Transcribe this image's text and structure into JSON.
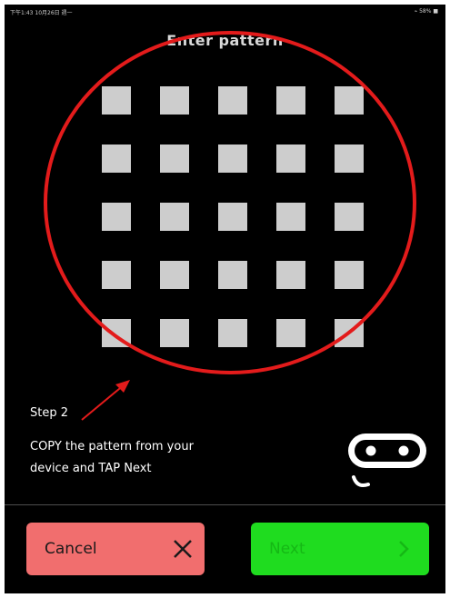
{
  "status_bar": {
    "left": "下午1:43 10月26日 週一",
    "right": "⌁ 58% ■"
  },
  "screen": {
    "title": "Enter pattern"
  },
  "pattern": {
    "rows": 5,
    "cols": 5
  },
  "annotation": {
    "circle_color": "#e31b1b",
    "arrow_color": "#e31b1b"
  },
  "instructions": {
    "step": "Step 2",
    "line1": "COPY the pattern from your",
    "line2": "device and TAP Next"
  },
  "buttons": {
    "cancel_label": "Cancel",
    "next_label": "Next"
  },
  "icons": {
    "cancel": "close-icon",
    "next": "chevron-right-icon",
    "device": "robot-face-icon"
  },
  "colors": {
    "background": "#000000",
    "cell": "#cdcdcd",
    "cancel": "#f16e6e",
    "next": "#1fdc1f",
    "next_text": "#15b815",
    "annotation": "#e31b1b"
  }
}
